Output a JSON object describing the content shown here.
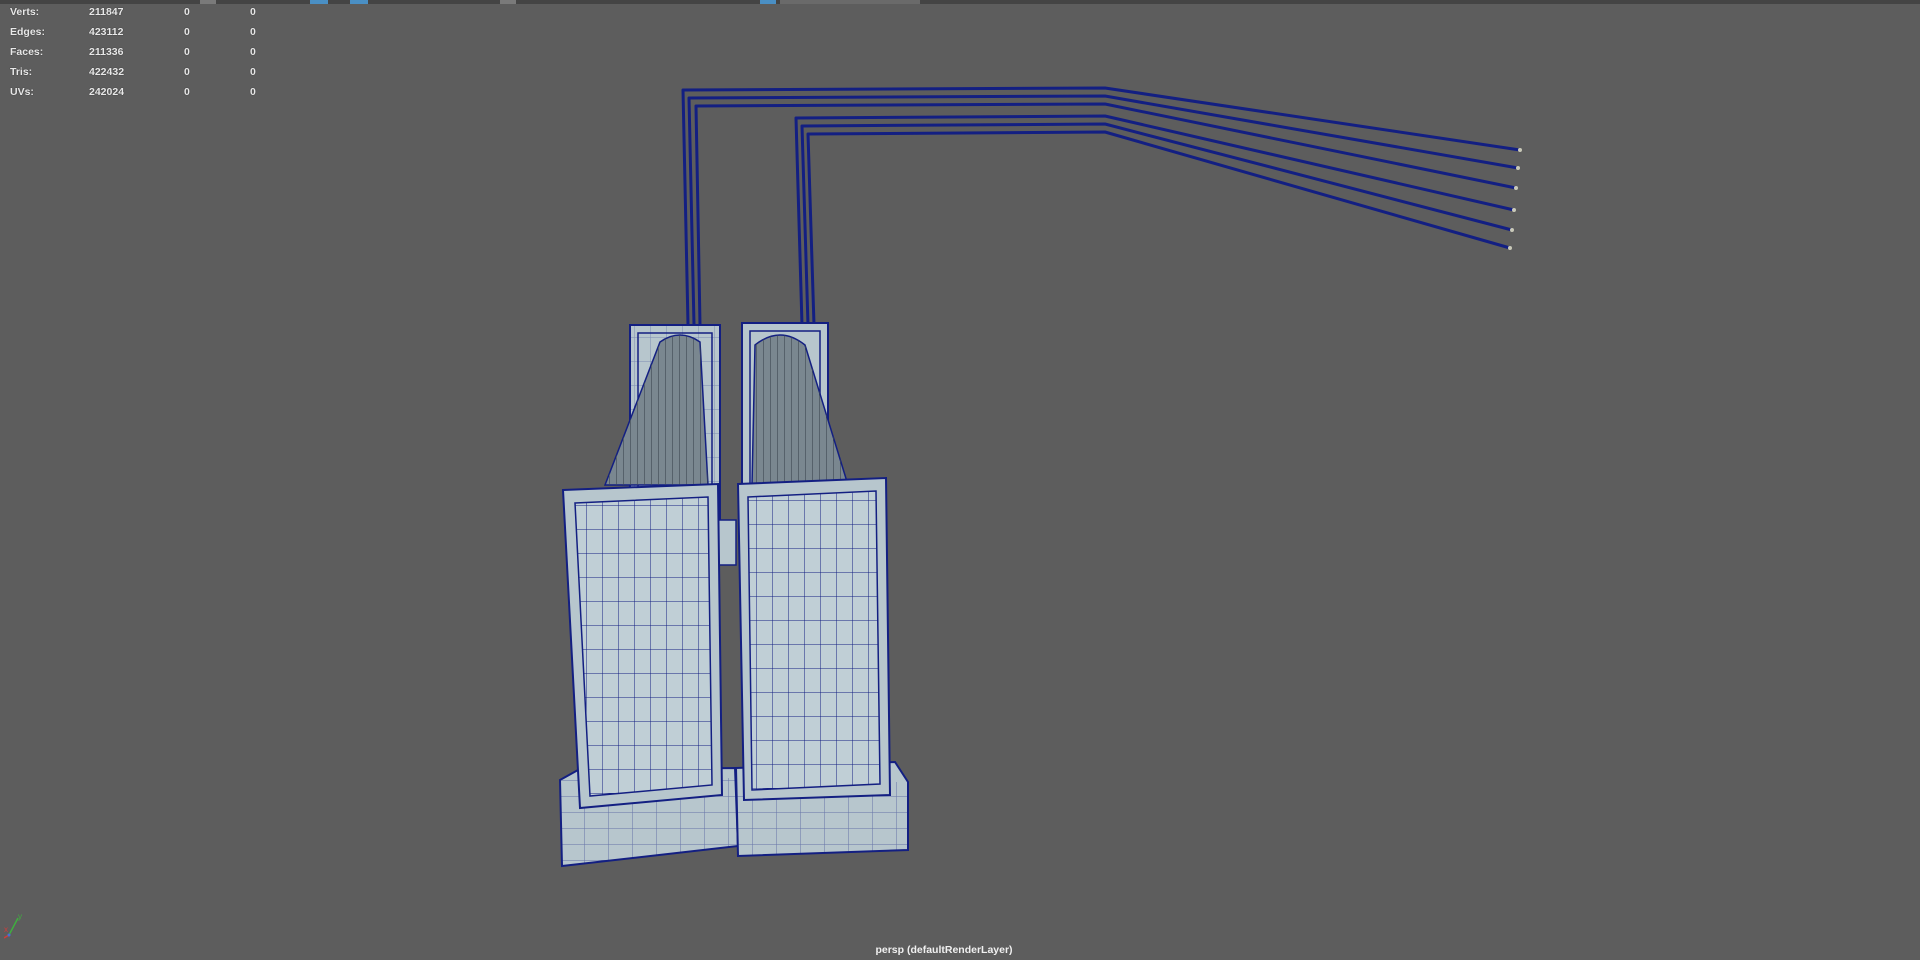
{
  "hud": {
    "rows": [
      {
        "label": "Verts:",
        "total": "211847",
        "selected": "0",
        "component": "0"
      },
      {
        "label": "Edges:",
        "total": "423112",
        "selected": "0",
        "component": "0"
      },
      {
        "label": "Faces:",
        "total": "211336",
        "selected": "0",
        "component": "0"
      },
      {
        "label": "Tris:",
        "total": "422432",
        "selected": "0",
        "component": "0"
      },
      {
        "label": "UVs:",
        "total": "242024",
        "selected": "0",
        "component": "0"
      }
    ]
  },
  "camera_label": "persp (defaultRenderLayer)",
  "axis": {
    "y_label": "y",
    "x_label": "x"
  },
  "colors": {
    "viewport_bg": "#5d5d5d",
    "wire": "#131f82",
    "mesh_fill": "#b7c6cd",
    "mesh_dark": "#6c7880",
    "accent_blue": "#4a8fc4"
  },
  "scene": {
    "description_icon": "wireframe-mesh-icon"
  }
}
